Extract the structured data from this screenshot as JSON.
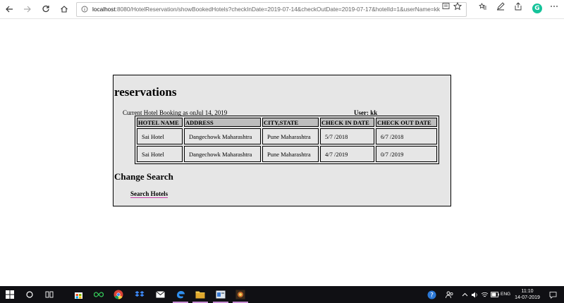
{
  "browser": {
    "url_host": "localhost",
    "url_rest": ":8080/HotelReservation/showBookedHotels?checkInDate=2019-07-14&checkOutDate=2019-07-17&hotelId=1&userName=kk"
  },
  "page": {
    "heading": "reservations",
    "booking_date_text": "Current Hotel Booking as onJul 14, 2019",
    "user_text": "User: kk",
    "table": {
      "headers": [
        "HOTEL NAME",
        "ADDRESS",
        "CITY,STATE",
        "CHECK IN DATE",
        "CHECK OUT DATE"
      ],
      "rows": [
        [
          "Sai Hotel",
          "Dangechowk Maharashtra",
          "Pune Maharashtra",
          "5/7 /2018",
          "6/7 /2018"
        ],
        [
          "Sai Hotel",
          "Dangechowk Maharashtra",
          "Pune Maharashtra",
          "4/7 /2019",
          "0/7 /2019"
        ]
      ]
    },
    "change_search_heading": "Change Search",
    "search_link": "Search Hotels"
  },
  "taskbar": {
    "language": "ENG",
    "time": "11:10",
    "date": "14-07-2019"
  }
}
